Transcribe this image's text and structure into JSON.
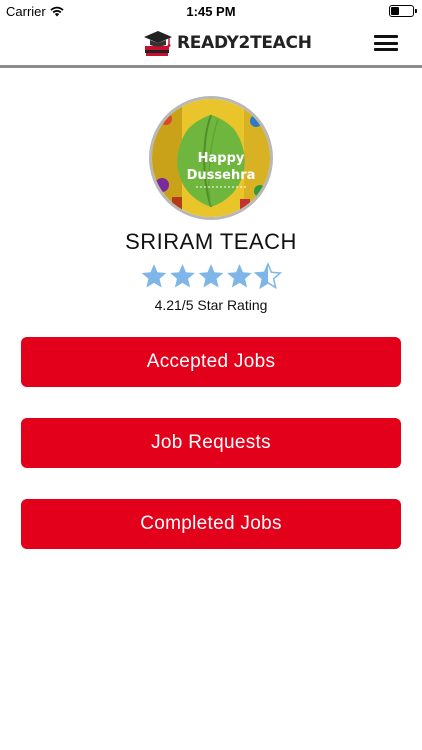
{
  "status_bar": {
    "carrier": "Carrier",
    "time": "1:45 PM"
  },
  "navbar": {
    "logo_text": "READY2TEACH",
    "menu_icon": "hamburger-menu-icon"
  },
  "profile": {
    "avatar_text_line1": "Happy",
    "avatar_text_line2": "Dussehra",
    "name": "SRIRAM TEACH",
    "rating": 4.21,
    "rating_max": 5,
    "rating_text": "4.21/5 Star Rating"
  },
  "actions": {
    "accepted_jobs": "Accepted Jobs",
    "job_requests": "Job Requests",
    "completed_jobs": "Completed Jobs"
  },
  "colors": {
    "accent": "#e3001b",
    "star": "#7fb6ea"
  }
}
